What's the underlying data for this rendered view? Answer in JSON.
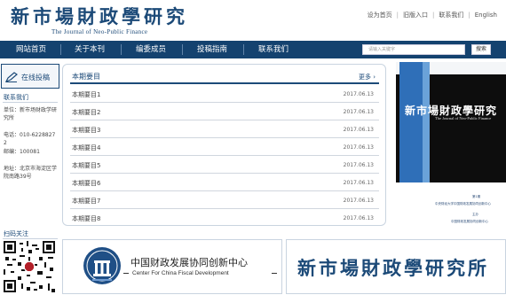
{
  "header": {
    "logo_cn": "新市場財政學研究",
    "logo_en": "The Journal of Neo-Public Finance",
    "links": [
      "设为首页",
      "旧版入口",
      "联系我们",
      "English"
    ]
  },
  "nav": {
    "items": [
      "网站首页",
      "关于本刊",
      "编委成员",
      "投稿指南",
      "联系我们"
    ],
    "search_placeholder": "请输入关键字",
    "search_button": "搜索"
  },
  "sidebar": {
    "submit_label": "在线投稿",
    "contact_title": "联系我们",
    "unit": "单位：新市场财政学研究所",
    "phone": "电话：010-62288272",
    "postcode": "邮编：100081",
    "address": "地址：北京市海淀区学院南路39号"
  },
  "main": {
    "title": "本期要目",
    "more": "更多 ›",
    "rows": [
      {
        "title": "本期要目1",
        "date": "2017.06.13"
      },
      {
        "title": "本期要目2",
        "date": "2017.06.13"
      },
      {
        "title": "本期要目3",
        "date": "2017.06.13"
      },
      {
        "title": "本期要目4",
        "date": "2017.06.13"
      },
      {
        "title": "本期要目5",
        "date": "2017.06.13"
      },
      {
        "title": "本期要目6",
        "date": "2017.06.13"
      },
      {
        "title": "本期要目7",
        "date": "2017.06.13"
      },
      {
        "title": "本期要目8",
        "date": "2017.06.13"
      }
    ]
  },
  "cover": {
    "title": "新市場財政學研究",
    "subtitle": "The Journal of Neo-Public Finance",
    "note1": "第1期",
    "note2": "中央财经大学中国财政发展协同创新中心",
    "note3": "主办",
    "note4": "中国财政发展协同创新中心"
  },
  "qr": {
    "title": "扫码关注"
  },
  "banner1": {
    "cn": "中国财政发展协同创新中心",
    "en": "Center For China Fiscal Development"
  },
  "banner2": {
    "text": "新市場財政學研究所"
  },
  "colors": {
    "brand": "#1c4a78",
    "nav_bg": "#14426f",
    "cover_blue": "#2f6fb8"
  }
}
